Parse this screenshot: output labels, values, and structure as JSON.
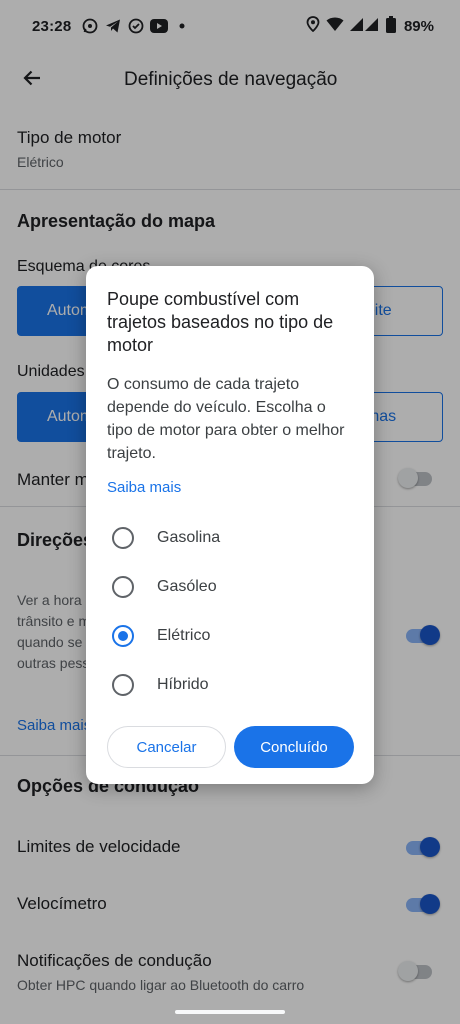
{
  "status_bar": {
    "time": "23:28",
    "battery": "89%",
    "icons": [
      "whatsapp-icon",
      "telegram-icon",
      "sync-icon",
      "youtube-icon",
      "dot-icon",
      "location-icon",
      "wifi-icon",
      "signal-icon",
      "battery-icon"
    ]
  },
  "app_bar": {
    "title": "Definições de navegação",
    "back_icon": "arrow-back-icon"
  },
  "settings": {
    "engine": {
      "title": "Tipo de motor",
      "value": "Elétrico"
    },
    "map_section": "Apresentação do mapa",
    "color_scheme": {
      "label": "Esquema de cores",
      "options": [
        "Automático",
        "Noite"
      ],
      "selected": 0
    },
    "units": {
      "label": "Unidades de distância",
      "options": [
        "Automático",
        "Milhas"
      ],
      "selected": 0
    },
    "keep_map_north": {
      "label": "Manter mapa com norte para cima",
      "on": false
    },
    "directions_section": "Direções por voz",
    "voice_desc": "Ver a hora de chegada ao destino seguinte, o estado do trânsito e mais, no ecrã de bloqueio ou do ecrã inicial quando se utiliza a navegação. (Não disponível para outras pessoas.)",
    "voice_toggle_on": true,
    "saiba_mais": "Saiba mais",
    "driving_section": "Opções de condução",
    "speed_limits": {
      "label": "Limites de velocidade",
      "on": true
    },
    "speedometer": {
      "label": "Velocímetro",
      "on": true
    },
    "notifications": {
      "label": "Notificações de condução",
      "sub": "Obter HPC quando ligar ao Bluetooth do carro",
      "on": false
    }
  },
  "dialog": {
    "title": "Poupe combustível com trajetos baseados no tipo de motor",
    "body": "O consumo de cada trajeto depende do veículo. Escolha o tipo de motor para obter o melhor trajeto.",
    "link": "Saiba mais",
    "options": [
      "Gasolina",
      "Gasóleo",
      "Elétrico",
      "Híbrido"
    ],
    "selected_option": "Elétrico",
    "cancel_label": "Cancelar",
    "done_label": "Concluído"
  },
  "colors": {
    "accent": "#1a73e8",
    "text_primary": "#202124",
    "text_secondary": "#5f6368"
  }
}
